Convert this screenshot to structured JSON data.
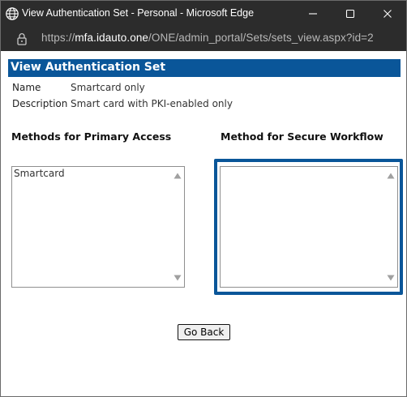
{
  "window": {
    "title": "View Authentication Set - Personal - Microsoft Edge",
    "icon": "globe-icon",
    "controls": [
      "minimize-icon",
      "maximize-icon",
      "close-icon"
    ]
  },
  "address": {
    "prefix": "https://",
    "host": "mfa.idauto.one",
    "path": "/ONE/admin_portal/Sets/sets_view.aspx?id=2",
    "icon": "lock-icon"
  },
  "page": {
    "heading": "View Authentication Set",
    "name_label": "Name",
    "name_value": "Smartcard only",
    "description_label": "Description",
    "description_value": "Smart card with PKI-enabled only",
    "primary_title": "Methods for Primary Access",
    "secure_title": "Method for Secure Workflow",
    "primary_items": [
      "Smartcard"
    ],
    "secure_items": [],
    "go_back_label": "Go Back"
  },
  "colors": {
    "header_bg": "#0a5699",
    "titlebar_bg": "#2c2c2c",
    "focus_ring": "#0a5699"
  }
}
